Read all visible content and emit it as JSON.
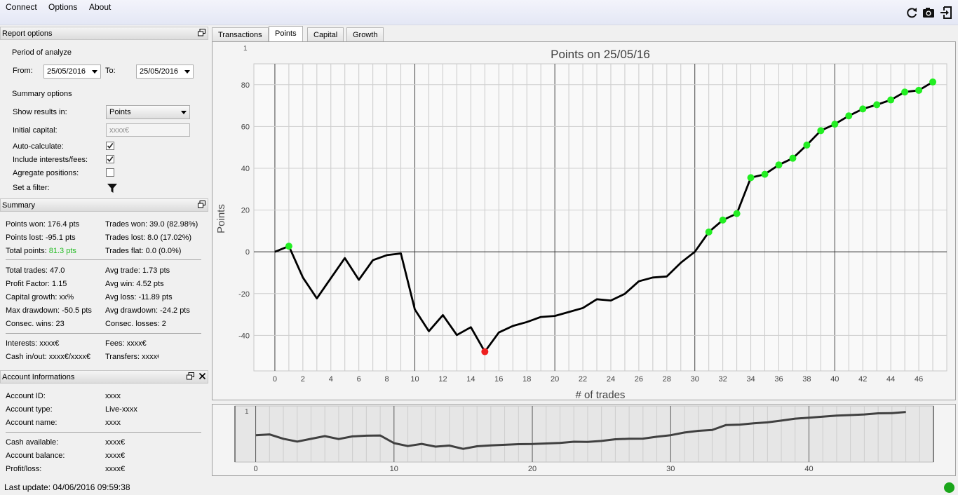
{
  "menu": {
    "items": [
      "Connect",
      "Options",
      "About"
    ]
  },
  "toolbar": {
    "icons": [
      "refresh-icon",
      "camera-icon",
      "export-icon"
    ]
  },
  "report_options": {
    "title": "Report options",
    "period_label": "Period of analyze",
    "from_label": "From:",
    "from_value": "25/05/2016",
    "to_label": "To:",
    "to_value": "25/05/2016",
    "summary_options_label": "Summary options",
    "show_results_label": "Show results in:",
    "show_results_value": "Points",
    "initial_capital_label": "Initial capital:",
    "initial_capital_placeholder": "xxxx€",
    "auto_calc_label": "Auto-calculate:",
    "auto_calc_checked": true,
    "include_fees_label": "Include interests/fees:",
    "include_fees_checked": true,
    "aggregate_label": "Agregate positions:",
    "aggregate_checked": false,
    "filter_label": "Set a filter:"
  },
  "summary": {
    "title": "Summary",
    "points_won": "Points won: 176.4 pts",
    "trades_won": "Trades won: 39.0 (82.98%)",
    "points_lost": "Points lost: -95.1 pts",
    "trades_lost": "Trades lost: 8.0 (17.02%)",
    "total_points_label": "Total points:",
    "total_points_value": "81.3 pts",
    "trades_flat": "Trades flat: 0.0 (0.0%)",
    "total_trades": "Total trades: 47.0",
    "avg_trade": "Avg trade: 1.73 pts",
    "profit_factor": "Profit Factor: 1.15",
    "avg_win": "Avg win: 4.52 pts",
    "capital_growth": "Capital growth: xx%",
    "avg_loss": "Avg loss: -11.89 pts",
    "max_drawdown": "Max drawdown: -50.5 pts",
    "avg_drawdown": "Avg drawdown: -24.2 pts",
    "consec_wins": "Consec. wins: 23",
    "consec_losses": "Consec. losses: 2",
    "interests": "Interests: xxxx€",
    "fees": "Fees: xxxx€",
    "cash_inout": "Cash in/out: xxxx€/xxxx€",
    "transfers": "Transfers: xxxx€",
    "accent_color": "#22bb22"
  },
  "account": {
    "title": "Account Informations",
    "id_label": "Account ID:",
    "id_value": "xxxx",
    "type_label": "Account type:",
    "type_value": "Live-xxxx",
    "name_label": "Account name:",
    "name_value": "xxxx",
    "cash_label": "Cash available:",
    "cash_value": "xxxx€",
    "balance_label": "Account balance:",
    "balance_value": "xxxx€",
    "pl_label": "Profit/loss:",
    "pl_value": "xxxx€"
  },
  "status": {
    "last_update": "Last update: 04/06/2016 09:59:38",
    "connected_color": "#1aa61a"
  },
  "tabs": [
    {
      "label": "Transactions",
      "active": false
    },
    {
      "label": "Points",
      "active": true
    },
    {
      "label": "Capital",
      "active": false
    },
    {
      "label": "Growth",
      "active": false
    }
  ],
  "chart_data": {
    "type": "line",
    "title": "Points on 25/05/16",
    "xlabel": "# of trades",
    "ylabel": "Points",
    "xlim": [
      -1.5,
      48
    ],
    "ylim": [
      -57,
      90
    ],
    "xticks": [
      0,
      2,
      4,
      6,
      8,
      10,
      12,
      14,
      16,
      18,
      20,
      22,
      24,
      26,
      28,
      30,
      32,
      34,
      36,
      38,
      40,
      42,
      44,
      46
    ],
    "yticks": [
      -40,
      -20,
      0,
      20,
      40,
      60,
      80
    ],
    "x": [
      0,
      1,
      2,
      3,
      4,
      5,
      6,
      7,
      8,
      9,
      10,
      11,
      12,
      13,
      14,
      15,
      16,
      17,
      18,
      19,
      20,
      21,
      22,
      23,
      24,
      25,
      26,
      27,
      28,
      29,
      30,
      31,
      32,
      33,
      34,
      35,
      36,
      37,
      38,
      39,
      40,
      41,
      42,
      43,
      44,
      45,
      46,
      47
    ],
    "y": [
      0,
      2.7,
      -12.3,
      -22.3,
      -12.6,
      -3,
      -13.4,
      -4,
      -1.6,
      -0.8,
      -27.6,
      -38,
      -30.3,
      -39.8,
      -36.1,
      -47.8,
      -38.6,
      -35.5,
      -33.6,
      -31.2,
      -30.7,
      -28.8,
      -26.9,
      -22.7,
      -23.3,
      -20.1,
      -14.1,
      -12.3,
      -11.8,
      -5.2,
      0,
      9.5,
      15.2,
      18.3,
      35.5,
      37.1,
      41.6,
      44.8,
      51.1,
      58,
      61.1,
      65.1,
      68.4,
      70.4,
      72.7,
      76.5,
      77.3,
      81.3
    ],
    "markers": {
      "new_high_color": "#22ee22",
      "low_color": "#ee2020",
      "line_color": "#000000",
      "low_index": 15
    },
    "grid": true,
    "navigator": {
      "xticks": [
        0,
        10,
        20,
        30,
        40
      ],
      "series_color": "#404040",
      "corner_label": "1"
    }
  }
}
